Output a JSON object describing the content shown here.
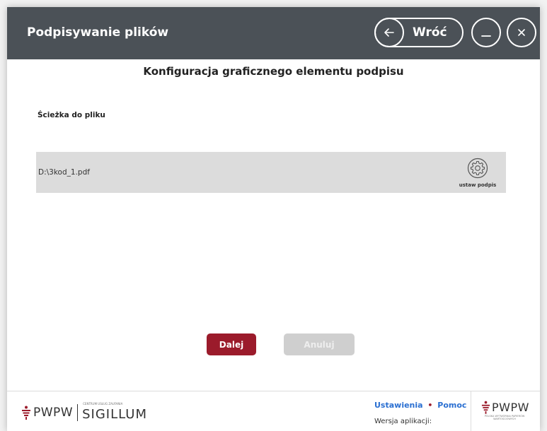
{
  "titlebar": {
    "title": "Podpisywanie plików",
    "back_label": "Wróć"
  },
  "main": {
    "heading": "Konfiguracja graficznego elementu podpisu",
    "path_label": "Ścieżka do pliku",
    "files": [
      {
        "path": "D:\\3kod_1.pdf",
        "action_label": "ustaw podpis"
      }
    ]
  },
  "actions": {
    "next_label": "Dalej",
    "cancel_label": "Anuluj"
  },
  "footer": {
    "left_logo_brand": "PWPW",
    "left_logo_caption": "CENTRUM USŁUG ZAUFANIA",
    "left_logo_product": "SIGILLUM",
    "settings_link": "Ustawienia",
    "separator": "•",
    "help_link": "Pomoc",
    "version_label": "Wersja aplikacji:",
    "right_logo_brand": "PWPW",
    "right_logo_caption": "POLSKA WYTWÓRNIA PAPIERÓW WARTOŚCIOWYCH"
  },
  "colors": {
    "titlebar_bg": "#4b5157",
    "accent": "#9b1b2b",
    "disabled": "#cfcfcf",
    "link": "#2a6fd1"
  },
  "icons": {
    "back": "arrow-left-icon",
    "minimize": "minimize-icon",
    "close": "close-icon",
    "signature_settings": "gear-icon",
    "brand_mark": "pwpw-mark-icon"
  }
}
